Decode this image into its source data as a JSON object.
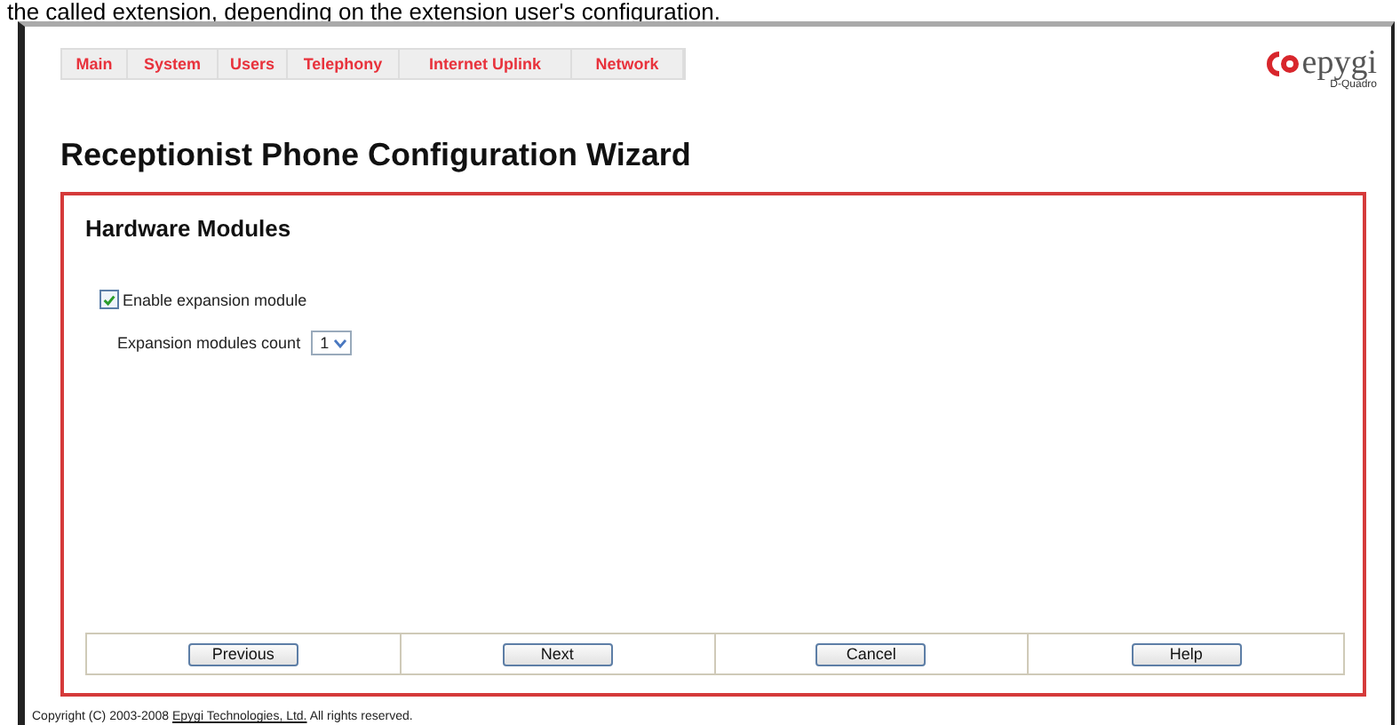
{
  "caption": "the called extension, depending on the extension user's configuration.",
  "nav": [
    {
      "label": "Main"
    },
    {
      "label": "System"
    },
    {
      "label": "Users"
    },
    {
      "label": "Telephony"
    },
    {
      "label": "Internet Uplink"
    },
    {
      "label": "Network"
    }
  ],
  "logo": {
    "brand": "epygi",
    "model": "D-Quadro"
  },
  "title": "Receptionist Phone Configuration Wizard",
  "panel": {
    "heading": "Hardware Modules",
    "enable_expansion": {
      "label": "Enable expansion module",
      "checked": true
    },
    "count": {
      "label": "Expansion modules count",
      "value": "1"
    }
  },
  "buttons": [
    {
      "label": "Previous"
    },
    {
      "label": "Next"
    },
    {
      "label": "Cancel"
    },
    {
      "label": "Help"
    }
  ],
  "footer": {
    "text_before": "Copyright (C) 2003-2008",
    "link": "Epygi Technologies, Ltd.",
    "text_after": "All rights reserved."
  }
}
